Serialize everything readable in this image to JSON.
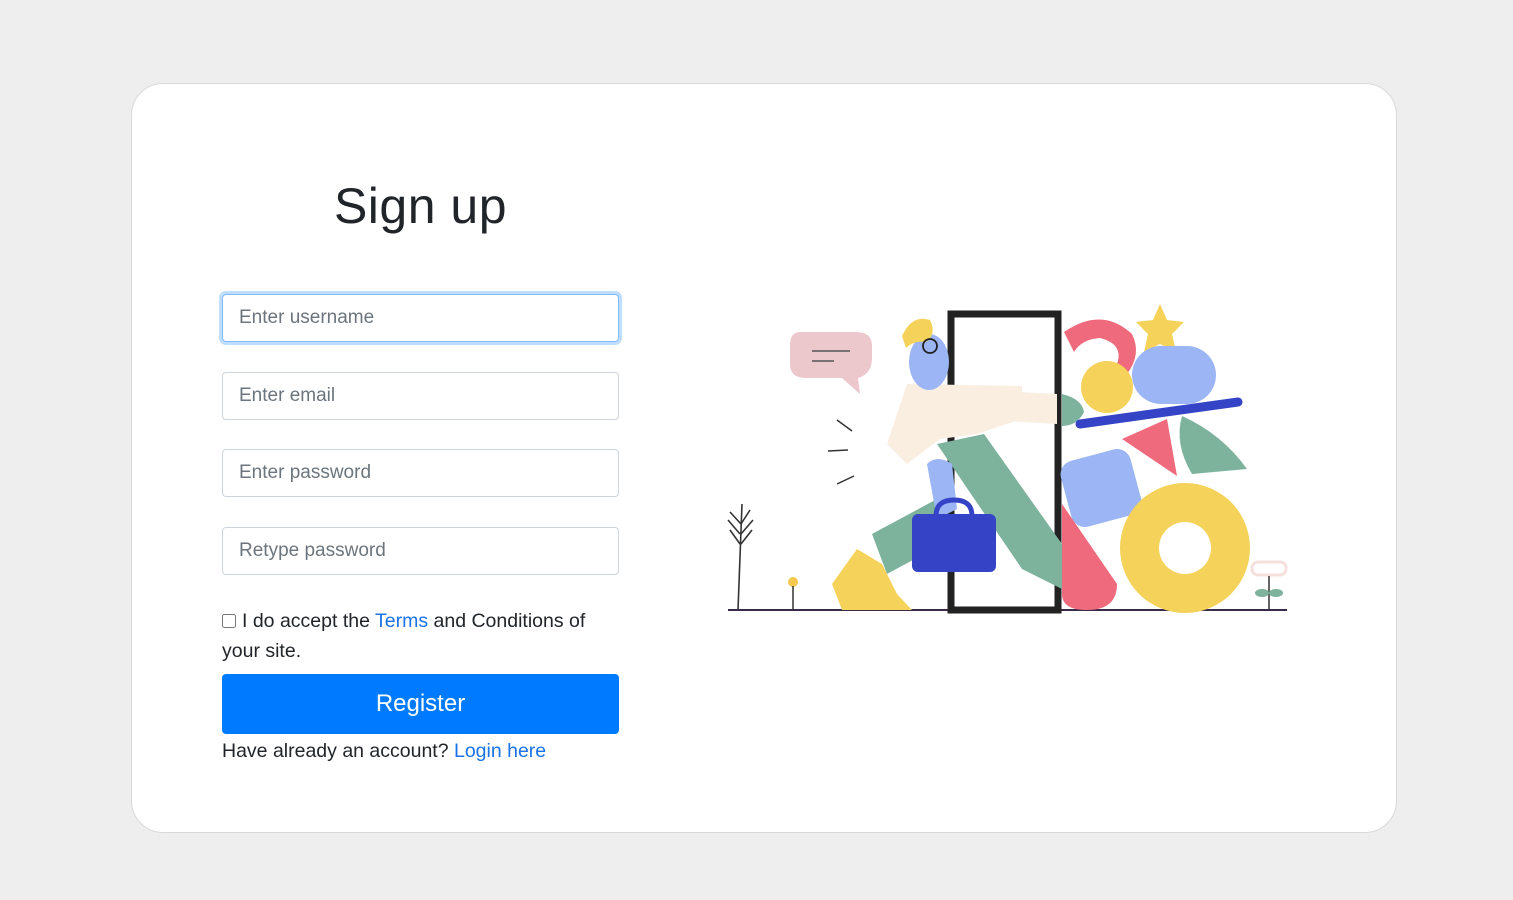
{
  "form": {
    "title": "Sign up",
    "username_placeholder": "Enter username",
    "email_placeholder": "Enter email",
    "password_placeholder": "Enter password",
    "retype_placeholder": "Retype password",
    "terms_prefix": "I do accept the ",
    "terms_link": "Terms",
    "terms_suffix": " and Conditions of your site.",
    "register_label": "Register",
    "login_prompt": "Have already an account? ",
    "login_link": "Login here",
    "terms_checked": false
  },
  "colors": {
    "page_bg": "#eeeeee",
    "card_bg": "#ffffff",
    "primary": "#007bff",
    "link": "#1a73e8"
  },
  "illustration": {
    "icon": "person-opening-door-with-shapes-illustration"
  }
}
